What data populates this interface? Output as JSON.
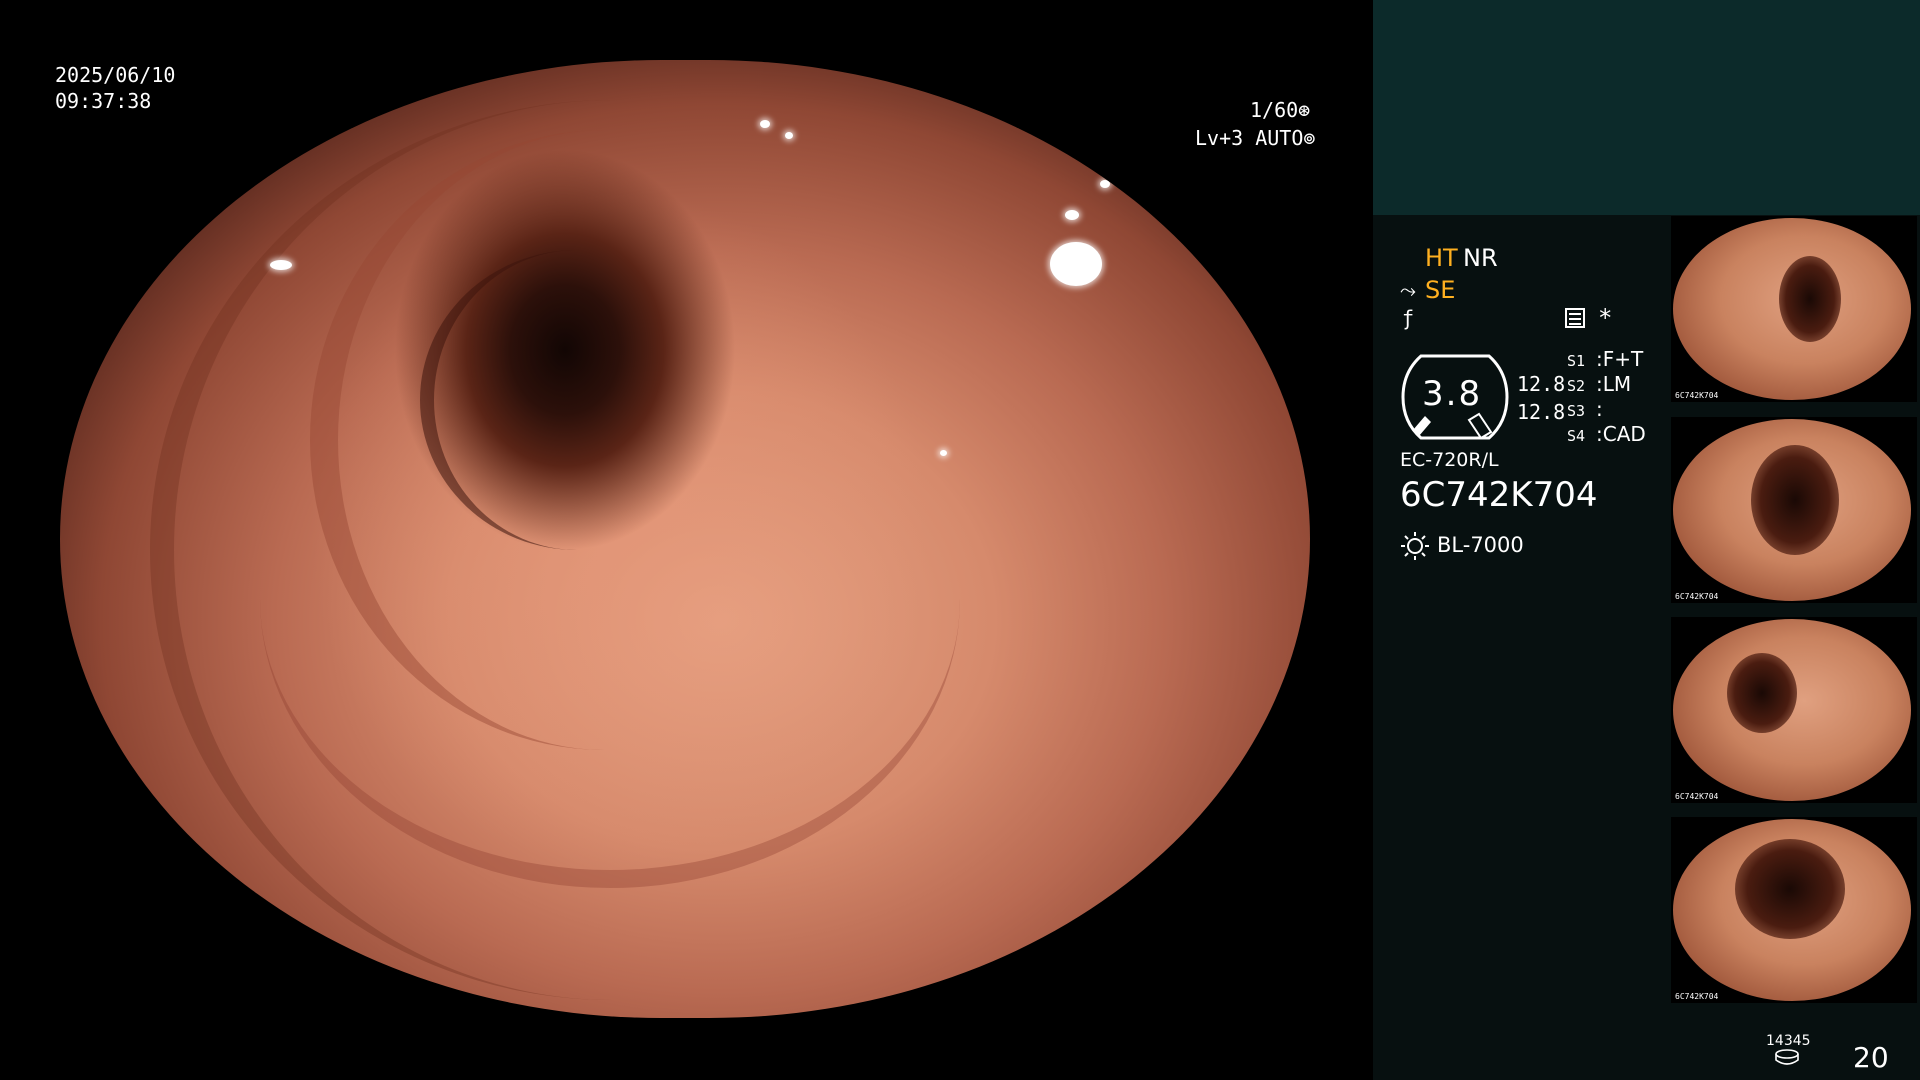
{
  "overlay": {
    "date": "2025/06/10",
    "time": "09:37:38",
    "shutter": "1/60",
    "shutter_icon": "aperture-icon",
    "level": "Lv+3",
    "mode": "AUTO",
    "mode_icon": "auto-iris-icon"
  },
  "panel": {
    "ht": "HT",
    "nr": "NR",
    "se": "SE",
    "se_icon": "structure-enhance-icon",
    "f_icon": "filter-icon",
    "menu_icon": "menu-list-icon",
    "star": "*",
    "gauge_value": "3.8",
    "val_top": "12.8",
    "val_bottom": "12.8",
    "switches": [
      {
        "key": "S1",
        "value": "F+T"
      },
      {
        "key": "S2",
        "value": "LM"
      },
      {
        "key": "S3",
        "value": ""
      },
      {
        "key": "S4",
        "value": "CAD"
      }
    ],
    "model": "EC-720R/L",
    "serial": "6C742K704",
    "light_source": "BL-7000",
    "light_icon": "lamp-icon",
    "image_count_small": "14345",
    "image_count": "20",
    "disk_icon": "storage-icon"
  },
  "thumbnails": [
    {
      "caption": "6C742K704"
    },
    {
      "caption": "6C742K704"
    },
    {
      "caption": "6C742K704"
    },
    {
      "caption": "6C742K704"
    }
  ],
  "colors": {
    "accent": "#ffb020",
    "panel_bg": "#071010",
    "panel_top": "#0c2a2a"
  }
}
